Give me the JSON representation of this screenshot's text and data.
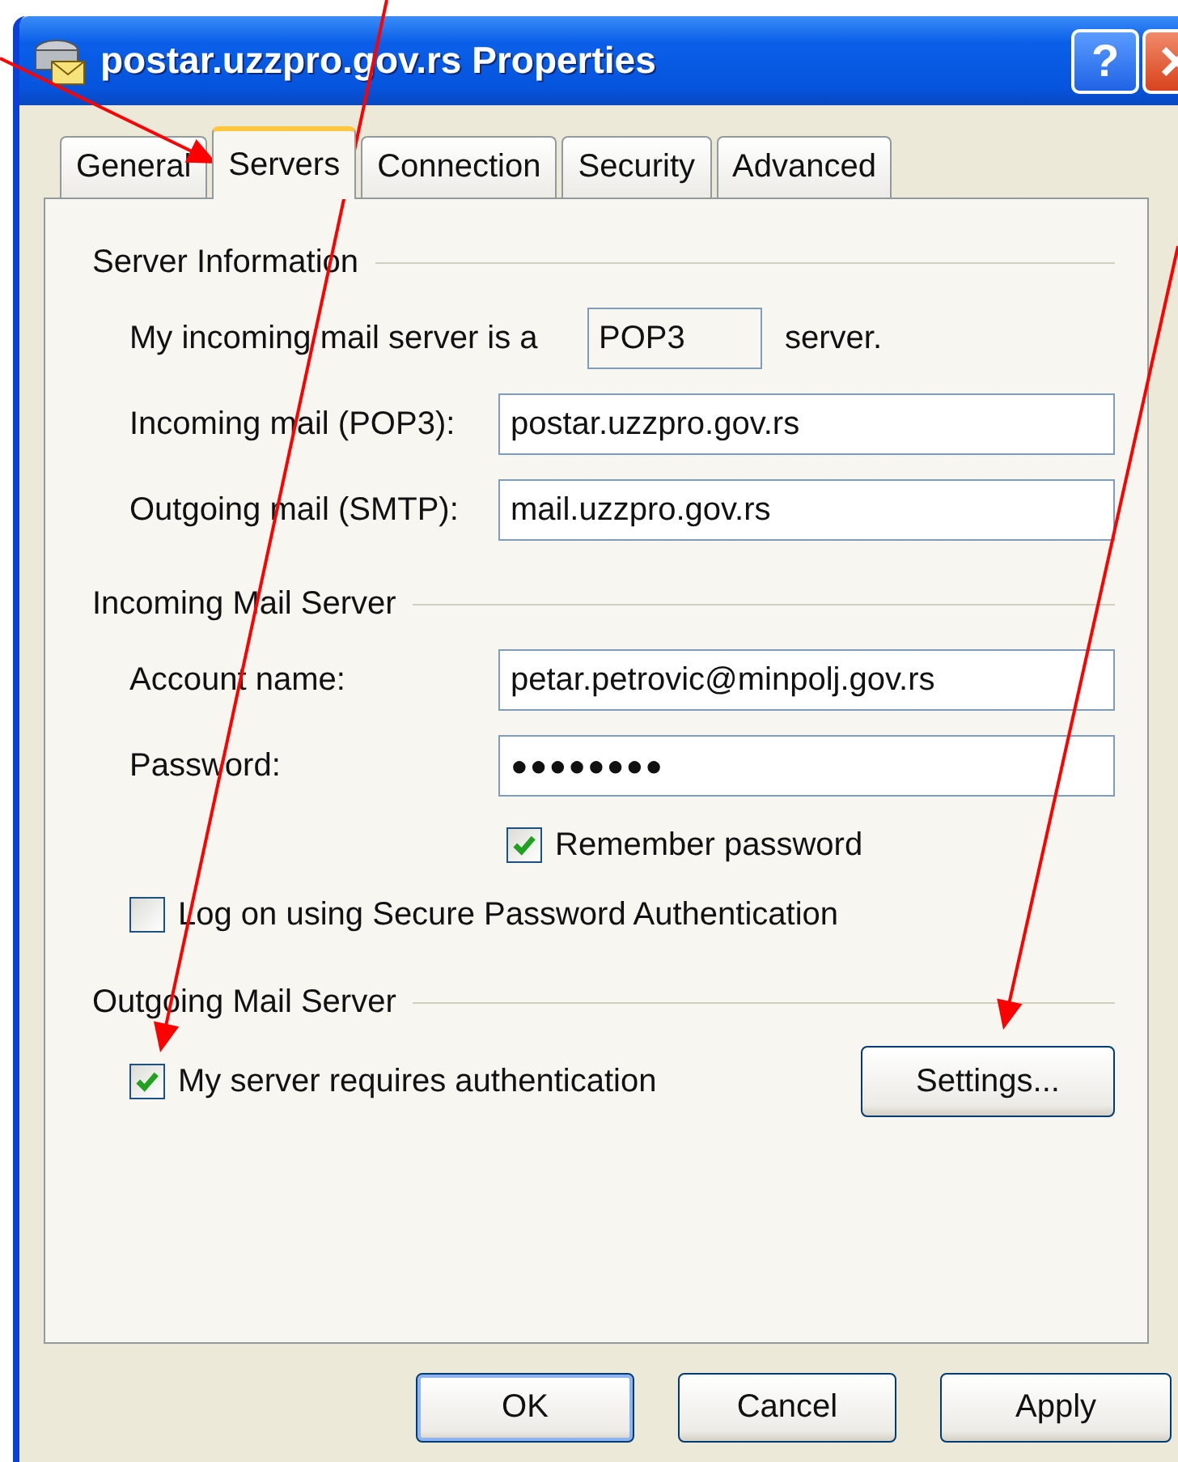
{
  "window": {
    "title": "postar.uzzpro.gov.rs Properties",
    "help": "?"
  },
  "tabs": [
    {
      "label": "General",
      "selected": false
    },
    {
      "label": "Servers",
      "selected": true
    },
    {
      "label": "Connection",
      "selected": false
    },
    {
      "label": "Security",
      "selected": false
    },
    {
      "label": "Advanced",
      "selected": false
    }
  ],
  "sections": [
    {
      "title": "Server Information",
      "rows": [
        {
          "kind": "type",
          "label": "My incoming mail server is a",
          "value": "POP3",
          "suffix": "server."
        },
        {
          "kind": "field",
          "label": "Incoming mail (POP3):",
          "value": "postar.uzzpro.gov.rs"
        },
        {
          "kind": "field",
          "label": "Outgoing mail (SMTP):",
          "value": "mail.uzzpro.gov.rs"
        }
      ]
    },
    {
      "title": "Incoming Mail Server",
      "rows": [
        {
          "kind": "field",
          "label": "Account name:",
          "value": "petar.petrovic@minpolj.gov.rs"
        },
        {
          "kind": "password",
          "label": "Password:",
          "value": "●●●●●●●●"
        },
        {
          "kind": "subcheck",
          "label": "Remember password",
          "checked": true
        },
        {
          "kind": "check",
          "label": "Log on using Secure Password Authentication",
          "checked": false
        }
      ]
    },
    {
      "title": "Outgoing Mail Server",
      "rows": [
        {
          "kind": "check-button",
          "label": "My server requires authentication",
          "checked": true,
          "button": "Settings..."
        }
      ]
    }
  ],
  "buttons": [
    {
      "label": "OK",
      "default": true
    },
    {
      "label": "Cancel",
      "default": false
    },
    {
      "label": "Apply",
      "default": false
    }
  ]
}
